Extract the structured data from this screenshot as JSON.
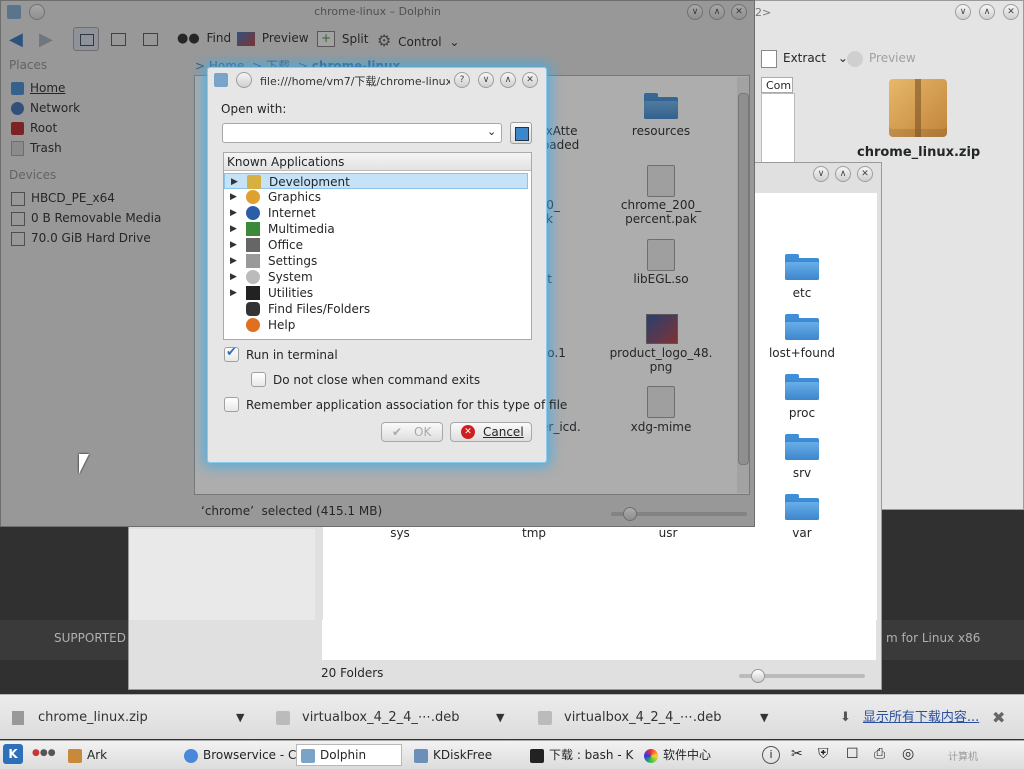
{
  "dolphin": {
    "title": "chrome-linux – Dolphin",
    "toolbar": {
      "find": "Find",
      "preview": "Preview",
      "split": "Split",
      "control": "Control"
    },
    "breadcrumb": {
      "home": "Home",
      "sep1": ">",
      "dl": "下载",
      "sep2": ">",
      "current": "chrome-linux"
    },
    "places_header": "Places",
    "places": [
      "Home",
      "Network",
      "Root",
      "Trash"
    ],
    "devices_header": "Devices",
    "devices": [
      "HBCD_PE_x64",
      "0 B Removable Media",
      "70.0 GiB Hard Drive"
    ],
    "files": {
      "f1": "boxAtte\nnloaded",
      "resources": "resources",
      "f2": "200_\npak",
      "chrome200": "chrome_200_\npercent.pak",
      "f3": "st",
      "libegl": "libEGL.so",
      "f4": "so.1",
      "product_logo": "product_logo_48.\npng",
      "f5": "er_icd.",
      "xdgmime": "xdg-mime"
    },
    "status": "‘chrome’  selected (415.1 MB)"
  },
  "ark": {
    "extract": "Extract",
    "preview": "Preview",
    "col": "Com",
    "file": "chrome_linux.zip",
    "title_tail": "2>"
  },
  "rootwin": {
    "folders": [
      "etc",
      "lost+found",
      "proc",
      "srv",
      "var"
    ],
    "bottom_labels": [
      "sys",
      "tmp",
      "usr"
    ],
    "status": "20 Folders"
  },
  "background": {
    "supported": "SUPPORTED",
    "linux_note": "m for Linux x86"
  },
  "dialog": {
    "title": "file:///home/vm7/下载/chrome-linux⋯",
    "open_with": "Open with:",
    "input_value": "",
    "known_header": "Known Applications",
    "apps": [
      "Development",
      "Graphics",
      "Internet",
      "Multimedia",
      "Office",
      "Settings",
      "System",
      "Utilities",
      "Find Files/Folders",
      "Help"
    ],
    "run_in_terminal": "Run in terminal",
    "do_not_close": "Do not close when command exits",
    "remember": "Remember application association for this type of file",
    "ok": "OK",
    "cancel": "Cancel",
    "help_btn": "?"
  },
  "downloads": {
    "items": [
      "chrome_linux.zip",
      "virtualbox_4_2_4_⋯.deb",
      "virtualbox_4_2_4_⋯.deb"
    ],
    "show_all": "显示所有下载内容..."
  },
  "taskbar": {
    "start": "K",
    "items": [
      "Ark",
      "Browservice - C",
      "Dolphin",
      "KDiskFree",
      "下载 : bash - K",
      "软件中心"
    ],
    "tray_text": "计算机"
  },
  "colors": {
    "accent": "#3daee9",
    "selection": "#bfe0f7",
    "cancel_red": "#d01f1f",
    "folder_blue": "#3c86cc"
  }
}
